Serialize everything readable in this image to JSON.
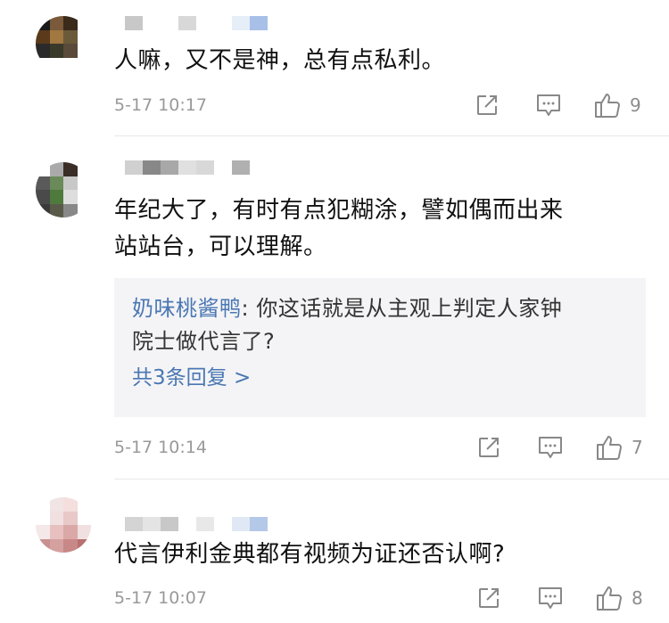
{
  "comments": [
    {
      "text_lines": [
        "人嘛，又不是神，总有点私利。"
      ],
      "time": "5-17 10:17",
      "likes": "9",
      "share_icon": "share-icon",
      "reply_icon": "comment-icon",
      "like_icon": "thumbs-up-icon"
    },
    {
      "text_lines": [
        "年纪大了，有时有点犯糊涂，譬如偶而出来",
        "站站台，可以理解。"
      ],
      "reply": {
        "author": "奶味桃酱鸭",
        "line1": ": 你这话就是从主观上判定人家钟",
        "line2": "院士做代言了?",
        "more": "共3条回复 >"
      },
      "time": "5-17 10:14",
      "likes": "7",
      "share_icon": "share-icon",
      "reply_icon": "comment-icon",
      "like_icon": "thumbs-up-icon"
    },
    {
      "text_lines": [
        "代言伊利金典都有视频为证还否认啊?"
      ],
      "time": "5-17 10:07",
      "likes": "8",
      "share_icon": "share-icon",
      "reply_icon": "comment-icon",
      "like_icon": "thumbs-up-icon"
    }
  ],
  "colors": {
    "link": "#4a77b3",
    "meta": "#999999",
    "reply_bg": "#f4f4f6"
  }
}
